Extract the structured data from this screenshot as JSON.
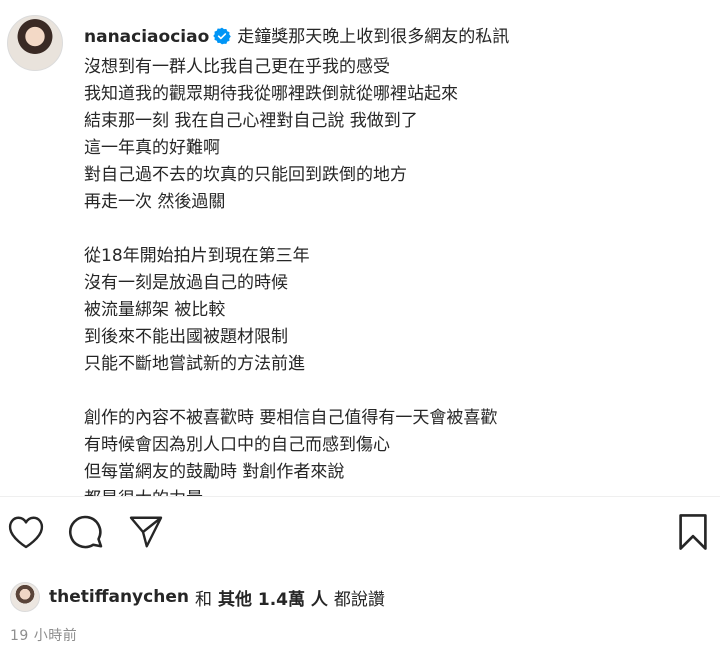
{
  "post": {
    "username": "nanaciaociao",
    "caption_lines": [
      "走鐘獎那天晚上收到很多網友的私訊",
      "沒想到有一群人比我自己更在乎我的感受",
      "我知道我的觀眾期待我從哪裡跌倒就從哪裡站起來",
      "結束那一刻 我在自己心裡對自己說 我做到了",
      "這一年真的好難啊",
      "對自己過不去的坎真的只能回到跌倒的地方",
      "再走一次 然後過關",
      "",
      "從18年開始拍片到現在第三年",
      "沒有一刻是放過自己的時候",
      "被流量綁架 被比較",
      "到後來不能出國被題材限制",
      "只能不斷地嘗試新的方法前進",
      "",
      "創作的內容不被喜歡時 要相信自己值得有一天會被喜歡",
      "有時候會因為別人口中的自己而感到傷心",
      "但每當網友的鼓勵時 對創作者來說",
      "都是很大的力量"
    ]
  },
  "actions": {
    "like_icon": "heart-icon",
    "comment_icon": "comment-icon",
    "share_icon": "paper-plane-icon",
    "save_icon": "bookmark-icon"
  },
  "likes": {
    "liker_username": "thetiffanychen",
    "and_text": "和",
    "others_text": "其他 1.4萬 人",
    "suffix_text": "都說讚"
  },
  "timestamp": "19 小時前",
  "colors": {
    "verified": "#0095f6",
    "text": "#262626",
    "muted": "#8e8e8e"
  }
}
